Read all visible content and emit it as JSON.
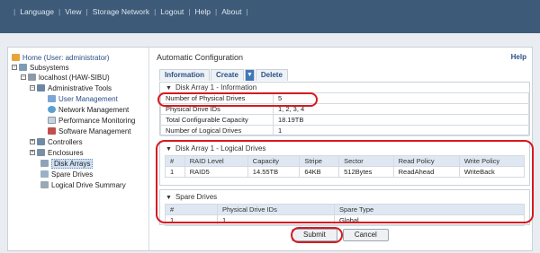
{
  "topmenu": [
    "Language",
    "View",
    "Storage Network",
    "Logout",
    "Help",
    "About"
  ],
  "tree": {
    "home": "Home (User: administrator)",
    "subsystems": "Subsystems",
    "host": "localhost (HAW-SIBU)",
    "admin_tools": "Administrative Tools",
    "user_mgmt": "User Management",
    "network_mgmt": "Network Management",
    "perf_mon": "Performance Monitoring",
    "software_mgmt": "Software Management",
    "controllers": "Controllers",
    "enclosures": "Enclosures",
    "disk_arrays": "Disk Arrays",
    "spare_drives": "Spare Drives",
    "logical_summary": "Logical Drive Summary"
  },
  "main": {
    "title": "Automatic Configuration",
    "help": "Help",
    "tabs": {
      "information": "Information",
      "create": "Create",
      "delete": "Delete"
    },
    "info_header": "Disk Array 1 - Information",
    "info_rows": [
      {
        "k": "Number of Physical Drives",
        "v": "5"
      },
      {
        "k": "Physical Drive IDs",
        "v": "1, 2, 3, 4"
      },
      {
        "k": "Total Configurable Capacity",
        "v": "18.19TB"
      },
      {
        "k": "Number of Logical Drives",
        "v": "1"
      }
    ],
    "logical": {
      "header": "Disk Array 1 - Logical Drives",
      "columns": [
        "#",
        "RAID Level",
        "Capacity",
        "Stripe",
        "Sector",
        "Read Policy",
        "Write Policy"
      ],
      "rows": [
        [
          "1",
          "RAID5",
          "14.55TB",
          "64KB",
          "512Bytes",
          "ReadAhead",
          "WriteBack"
        ]
      ]
    },
    "spare": {
      "header": "Spare Drives",
      "columns": [
        "#",
        "Physical Drive IDs",
        "Spare Type"
      ],
      "rows": [
        [
          "1",
          "1",
          "Global"
        ]
      ]
    },
    "submit": "Submit",
    "cancel": "Cancel"
  },
  "colors": {
    "topbar": "#3d5a78",
    "highlight": "#d7191f",
    "link": "#2a4f86"
  }
}
